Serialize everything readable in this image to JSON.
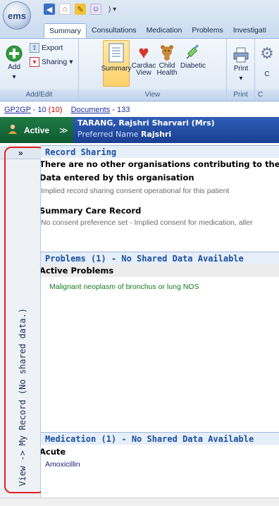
{
  "app": {
    "logo_text": "ems"
  },
  "ribbon_tabs": [
    {
      "label": "Summary",
      "active": true
    },
    {
      "label": "Consultations",
      "active": false
    },
    {
      "label": "Medication",
      "active": false
    },
    {
      "label": "Problems",
      "active": false
    },
    {
      "label": "Investigati",
      "active": false
    }
  ],
  "ribbon": {
    "add_label": "Add",
    "export_label": "Export",
    "sharing_label": "Sharing",
    "add_edit_group": "Add/Edit",
    "summary_label": "Summary",
    "cardiac_label_1": "Cardiac",
    "cardiac_label_2": "View",
    "child_label_1": "Child",
    "child_label_2": "Health",
    "diabetic_label": "Diabetic",
    "view_group": "View",
    "print_label": "Print",
    "print_group": "Print",
    "partial_label": "C",
    "partial_group": "C"
  },
  "counts": {
    "gp2gp_link": "GP2GP",
    "gp2gp_sep": " - 10 ",
    "gp2gp_red": "(10)",
    "documents_link": "Documents",
    "documents_count": " - 133"
  },
  "patient": {
    "status": "Active",
    "name": "TARANG, Rajshri Sharvari (Mrs)",
    "preferred_label": "Preferred Name",
    "preferred_name": "Rajshri"
  },
  "left_panel": {
    "collapse_glyph": "»",
    "vertical_label": "View -> My Record (No shared data.)"
  },
  "record_sharing": {
    "header": "Record Sharing",
    "line1": "There are no other organisations contributing to the Share",
    "subheader": "Data entered by this organisation",
    "line2": "Implied record sharing consent operational for this patient",
    "scr_header": "Summary Care Record",
    "line3": "No consent preference set - Implied consent for medication, aller"
  },
  "problems": {
    "header": "Problems (1) - No Shared Data Available",
    "subheader": "Active Problems",
    "items": [
      "Malignant neoplasm of bronchus or lung NOS"
    ]
  },
  "medication": {
    "header": "Medication (1) - No Shared Data Available",
    "subheader": "Acute",
    "items": [
      "Amoxicillin"
    ]
  },
  "colors": {
    "active_green": "#0f5a30",
    "banner_blue": "#1b3f8f",
    "section_blue": "#1b4fa0",
    "highlight_red": "#e0201e"
  }
}
